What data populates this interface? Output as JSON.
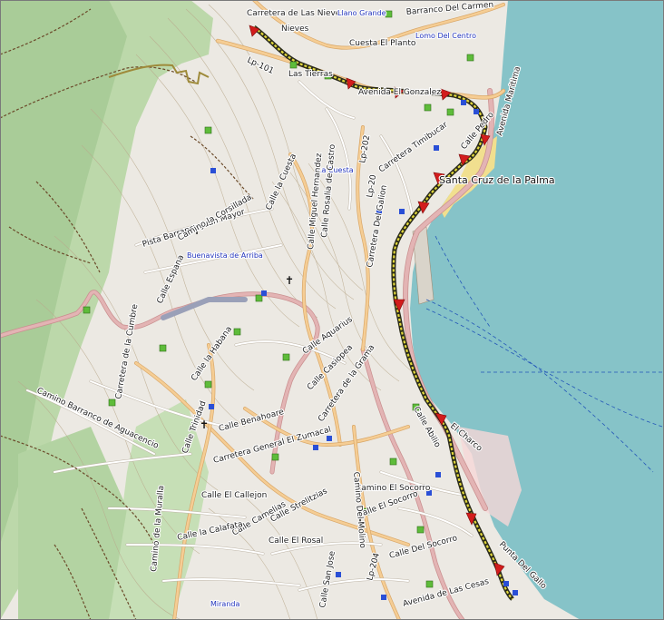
{
  "map": {
    "colors": {
      "land": "#ece9e3",
      "forest": "#b8d6a8",
      "forest_light": "#cfe3c2",
      "sea": "#86c3c8",
      "main_road": "#d7a3a3",
      "secondary_road": "#f2c98c",
      "minor_road": "#ffffff",
      "track": "#5a3e22",
      "contour": "#b9a98c",
      "route": "#2b2b1a",
      "route_marker": "#d21c1c",
      "poi_green": "#5ebc3a",
      "poi_blue": "#2a4fd6",
      "town_label": "#2233bb"
    },
    "town_name": "Santa Cruz de la Palma",
    "street_labels": [
      "Carretera de Las Nieves",
      "Cuesta El Planto",
      "Barranco Del Carmen",
      "Nieves",
      "Lp-101",
      "Las Tierras",
      "Avenida El Gonzalez",
      "Avenida Maritima",
      "Lp-202",
      "Carretera Timibucar",
      "Calle Pedro",
      "La Cuesta",
      "Calle la Cuesta",
      "Calle Miguel Hernandez",
      "Calle Rosalia de Castro",
      "Pista Barranco Juan Mayor",
      "Camino la Corsillada",
      "Lp-20",
      "Carretera Del Galion",
      "Calle Espana",
      "Calle Aquarius",
      "Calle Casiopea",
      "Carretera de la Cumbre",
      "Calle la Habana",
      "Carretera de la Grama",
      "Camino Barranco de Aguacencio",
      "Calle Trinidad",
      "Calle Benahoare",
      "Carretera General El Zumacal",
      "Calle El Callejon",
      "Calle Camelias",
      "Calle Strelitzias",
      "Camino El Socorro",
      "Calle El Socorro",
      "Calle El Rosal",
      "Calle la Calafata",
      "Camino de la Muralla",
      "Calle San Jose",
      "Calle Del Socorro",
      "Camino Del Molino",
      "Lp-204",
      "Avenida de Las Cesas",
      "Punta Del Gallo",
      "Calle Abilio",
      "El Charco"
    ],
    "place_labels": [
      "Llano Grande",
      "Lomo Del Centro",
      "Buenavista de Arriba",
      "Miranda"
    ],
    "route_markers": 12
  }
}
